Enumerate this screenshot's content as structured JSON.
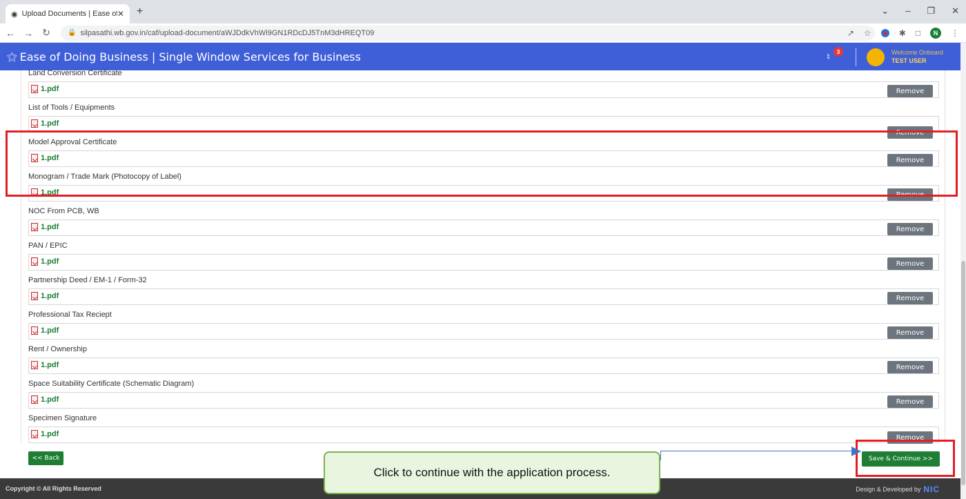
{
  "browser": {
    "tab_title": "Upload Documents | Ease of doi",
    "url": "silpasathi.wb.gov.in/caf/upload-document/aWJDdkVhWi9GN1RDcDJ5TnM3dHREQT09",
    "profile_initial": "N"
  },
  "header": {
    "brand": "Ease of Doing Business | Single Window Services for Business",
    "notification_count": "3",
    "welcome": "Welcome Onboard",
    "user": "TEST USER"
  },
  "documents": [
    {
      "label": "Land Conversion Certificate",
      "file": "1.pdf",
      "remove": "Remove"
    },
    {
      "label": "List of Tools / Equipments",
      "file": "1.pdf",
      "remove": "Remove"
    },
    {
      "label": "Model Approval Certificate",
      "file": "1.pdf",
      "remove": "Remove"
    },
    {
      "label": "Monogram / Trade Mark (Photocopy of Label)",
      "file": "1.pdf",
      "remove": "Remove"
    },
    {
      "label": "NOC From PCB, WB",
      "file": "1.pdf",
      "remove": "Remove"
    },
    {
      "label": "PAN / EPIC",
      "file": "1.pdf",
      "remove": "Remove"
    },
    {
      "label": "Partnership Deed / EM-1 / Form-32",
      "file": "1.pdf",
      "remove": "Remove"
    },
    {
      "label": "Professional Tax Reciept",
      "file": "1.pdf",
      "remove": "Remove"
    },
    {
      "label": "Rent / Ownership",
      "file": "1.pdf",
      "remove": "Remove"
    },
    {
      "label": "Space Suitability Certificate (Schematic Diagram)",
      "file": "1.pdf",
      "remove": "Remove"
    },
    {
      "label": "Specimen Signature",
      "file": "1.pdf",
      "remove": "Remove"
    }
  ],
  "actions": {
    "back": "<< Back",
    "save": "Save & Continue >>"
  },
  "footer": {
    "copyright": "Copyright © All Rights Reserved",
    "developed_by": "Design & Developed by",
    "nic": "NIC"
  },
  "callout": {
    "text": "Click to continue with the application process."
  },
  "colors": {
    "header_bg": "#3f5fd9",
    "button_green": "#1e7e34",
    "highlight_red": "#e51c23"
  }
}
